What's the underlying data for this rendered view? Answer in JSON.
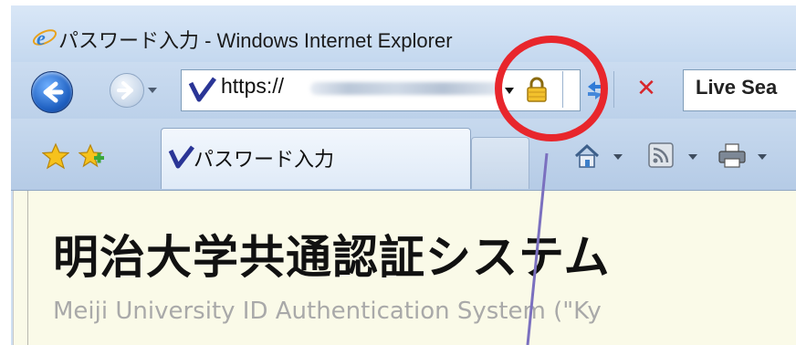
{
  "window": {
    "title": "パスワード入力 - Windows Internet Explorer"
  },
  "address_bar": {
    "url_prefix": "https://",
    "url_redacted": true
  },
  "search": {
    "label": "Live Sea"
  },
  "tabs": [
    {
      "label": "パスワード入力",
      "active": true
    }
  ],
  "page": {
    "heading": "明治大学共通認証システム",
    "subheading": "Meiji University ID Authentication System (\"Ky"
  },
  "icons": {
    "title": "ie-logo-icon",
    "back": "back-arrow-icon",
    "forward": "forward-arrow-icon",
    "site": "site-logo-icon",
    "lock": "padlock-icon",
    "refresh": "refresh-icon",
    "stop": "stop-icon",
    "favorites": "favorites-star-icon",
    "add_favorites": "add-favorites-icon",
    "home": "home-icon",
    "feeds": "rss-feed-icon",
    "print": "printer-icon"
  },
  "annotation": {
    "circle_color": "#e8262c",
    "pointer_color": "#7b70bf"
  },
  "colors": {
    "chrome": "#c4d8ef",
    "content_bg": "#fafae8",
    "site_logo": "#2a3596"
  }
}
